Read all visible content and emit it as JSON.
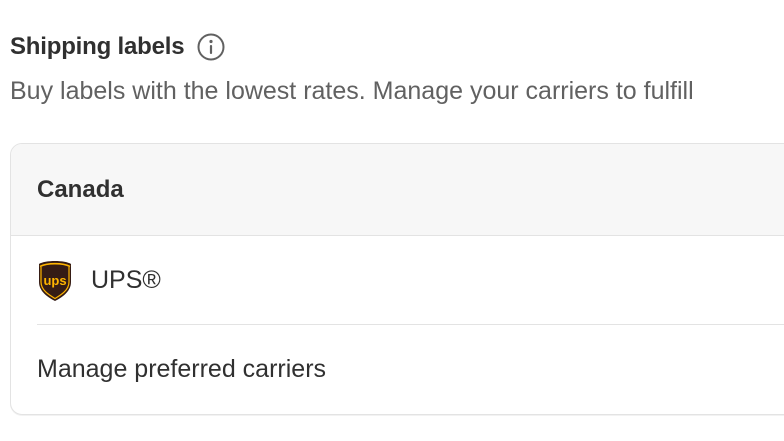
{
  "section": {
    "title": "Shipping labels",
    "info_icon": "info-icon",
    "description": "Buy labels with the lowest rates. Manage your carriers to fulfill"
  },
  "card": {
    "country": "Canada",
    "carriers": [
      {
        "name": "UPS®",
        "logo": "ups-logo"
      }
    ],
    "manage_label": "Manage preferred carriers"
  },
  "colors": {
    "title_text": "#303030",
    "muted_text": "#616161",
    "header_bg": "#f7f7f7",
    "border": "#e3e3e3",
    "ups_brown": "#351c15",
    "ups_gold": "#ffb500"
  }
}
